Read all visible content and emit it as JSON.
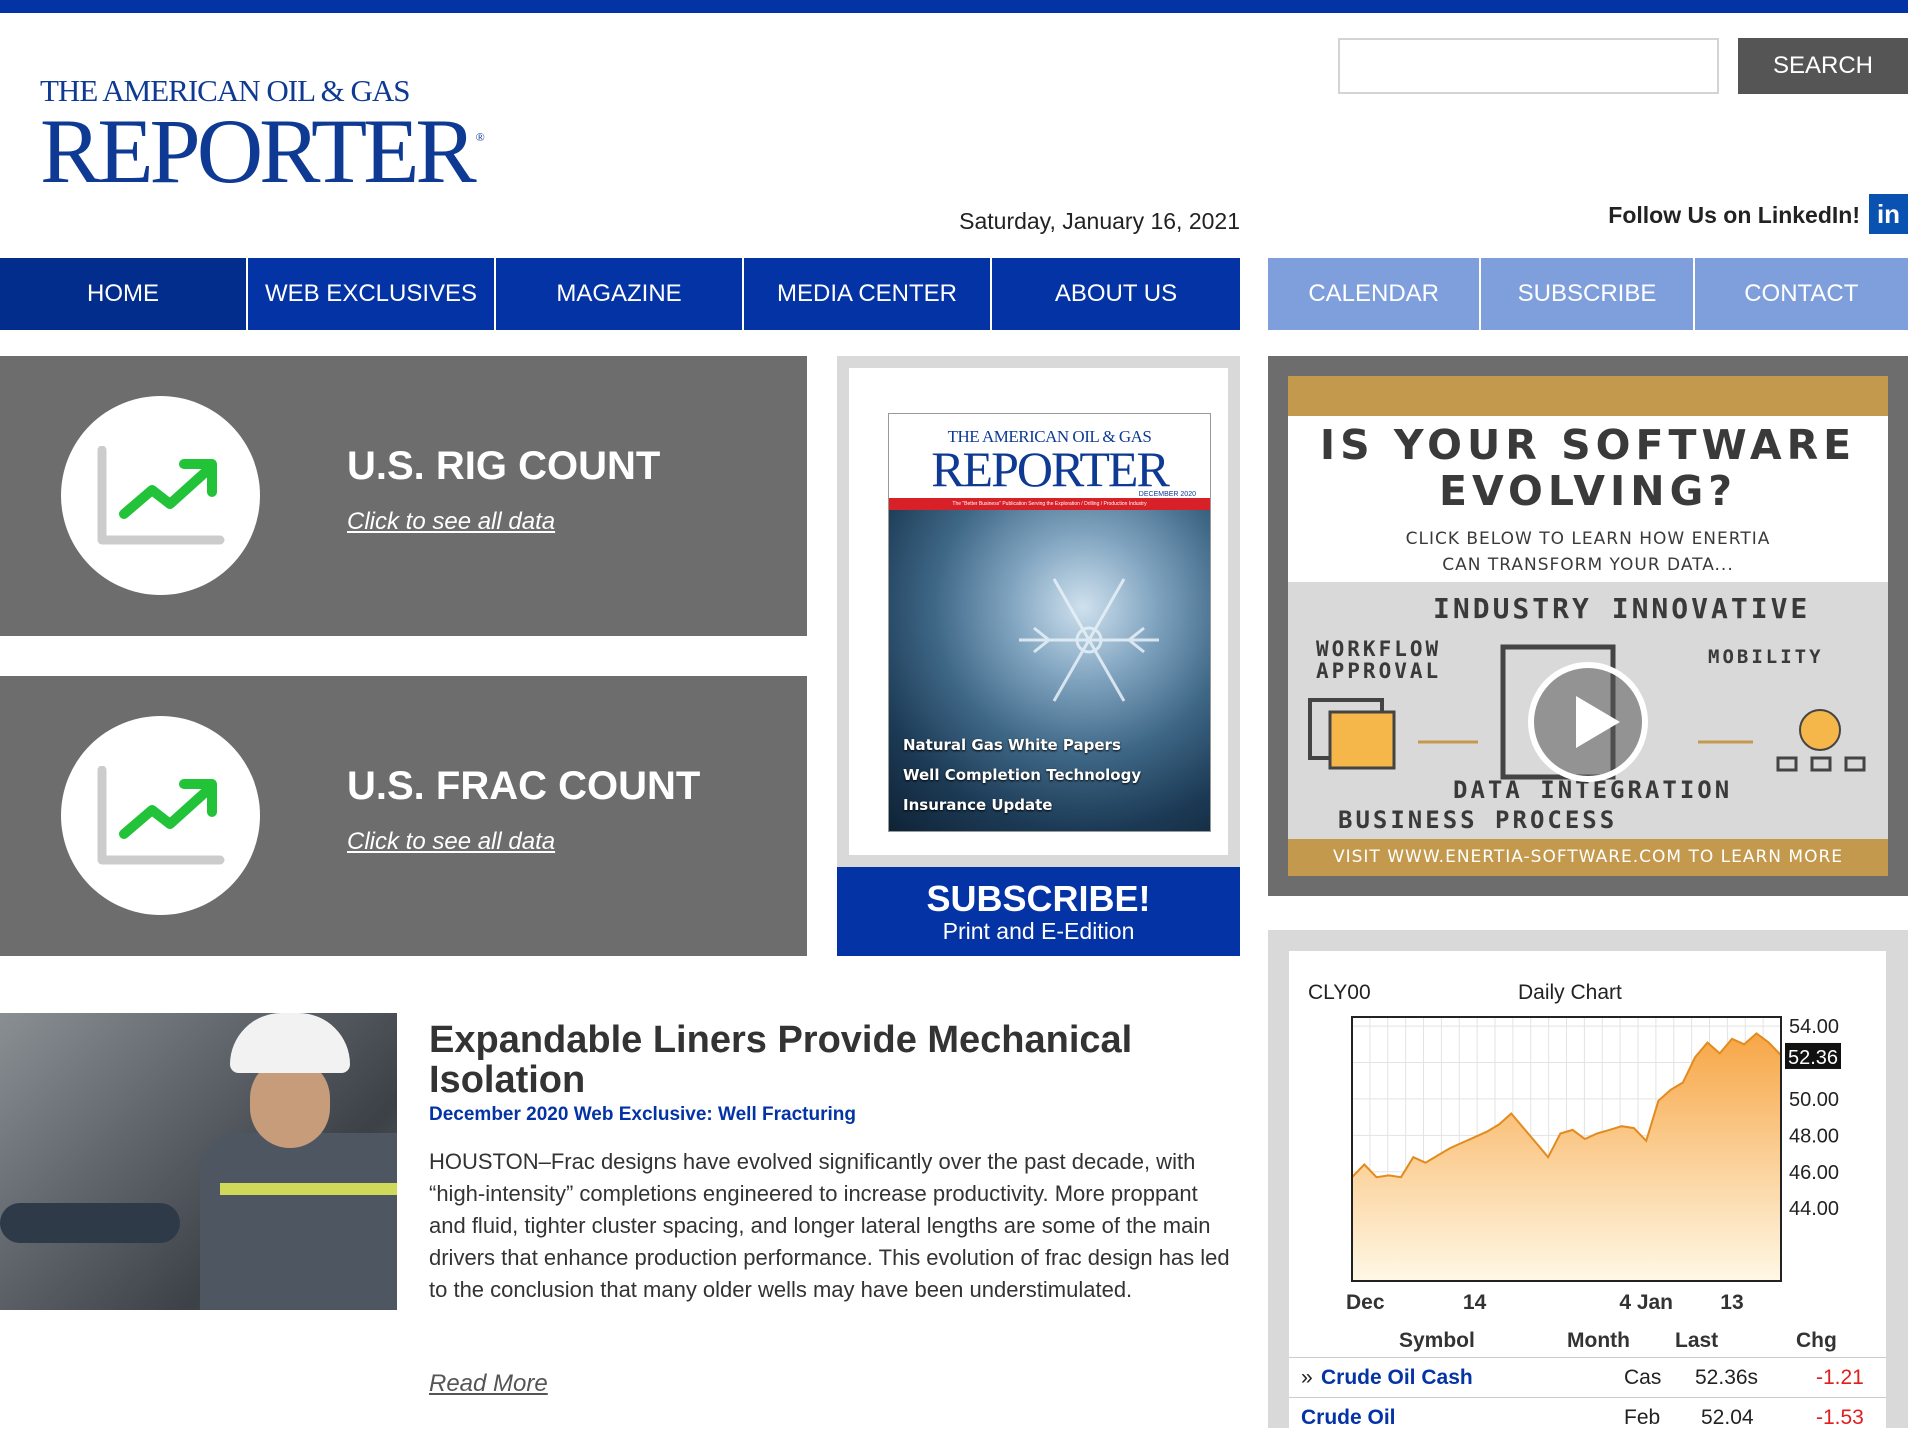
{
  "header": {
    "logo_line1": "THE AMERICAN OIL & GAS",
    "logo_line2": "REPORTER",
    "logo_reg": "®",
    "search_placeholder": "",
    "search_label": "SEARCH",
    "date": "Saturday, January 16, 2021",
    "follow_label": "Follow Us on LinkedIn!",
    "linkedin_icon": "in"
  },
  "nav": {
    "main": [
      {
        "label": "HOME"
      },
      {
        "label": "WEB EXCLUSIVES"
      },
      {
        "label": "MAGAZINE"
      },
      {
        "label": "MEDIA CENTER"
      },
      {
        "label": "ABOUT US"
      }
    ],
    "secondary": [
      {
        "label": "CALENDAR"
      },
      {
        "label": "SUBSCRIBE"
      },
      {
        "label": "CONTACT"
      }
    ]
  },
  "stats": [
    {
      "title": "U.S. RIG COUNT",
      "link": "Click to see all data",
      "icon": "trend-up-icon"
    },
    {
      "title": "U.S. FRAC COUNT",
      "link": "Click to see all data",
      "icon": "trend-up-icon"
    }
  ],
  "magazine": {
    "cover_line1": "THE AMERICAN OIL & GAS",
    "cover_line2": "REPORTER",
    "cover_date": "DECEMBER 2020",
    "cover_tagline": "The \"Better Business\" Publication Serving the Exploration / Drilling / Production Industry",
    "cover_items": [
      "Natural Gas White Papers",
      "Well Completion Technology",
      "Insurance Update"
    ],
    "subscribe_big": "SUBSCRIBE!",
    "subscribe_small": "Print and E-Edition"
  },
  "ad": {
    "headline1": "IS YOUR SOFTWARE",
    "headline2": "EVOLVING?",
    "sub1": "CLICK BELOW TO LEARN HOW ENERTIA",
    "sub2": "CAN TRANSFORM YOUR DATA...",
    "industry": "INDUSTRY INNOVATIVE",
    "workflow1": "WORKFLOW",
    "workflow2": "APPROVAL",
    "mobility": "MOBILITY",
    "data_integration": "DATA INTEGRATION",
    "business_process": "BUSINESS PROCESS",
    "visit": "VISIT   WWW.ENERTIA-SOFTWARE.COM   TO LEARN MORE"
  },
  "commodity": {
    "symbol": "CLY00",
    "chart_label": "Daily Chart",
    "last_price_tag": "52.36",
    "table_headers": {
      "symbol": "Symbol",
      "month": "Month",
      "last": "Last",
      "chg": "Chg"
    },
    "rows": [
      {
        "prefix": "»",
        "symbol": "Crude Oil Cash",
        "month": "Cas",
        "last": "52.36s",
        "chg": "-1.21"
      },
      {
        "prefix": "",
        "symbol": "Crude Oil",
        "month": "Feb",
        "last": "52.04",
        "chg": "-1.53"
      }
    ],
    "colors": {
      "fill_top": "#f7a646",
      "fill_bottom": "#fff8e6",
      "line": "#e38b1e"
    }
  },
  "chart_data": {
    "type": "area",
    "title": "Daily Chart",
    "x": [
      "Dec",
      "14",
      "4 Jan",
      "13"
    ],
    "y_ticks": [
      "54.00",
      "52.36",
      "50.00",
      "48.00",
      "46.00",
      "44.00"
    ],
    "ylim": [
      40,
      54.5
    ],
    "grid": true,
    "series": [
      {
        "values": [
          45.7,
          46.4,
          45.7,
          45.8,
          45.7,
          46.8,
          46.5,
          46.9,
          47.3,
          47.6,
          47.9,
          48.2,
          48.6,
          49.2,
          48.4,
          47.6,
          46.8,
          48.1,
          48.3,
          47.8,
          48.1,
          48.3,
          48.5,
          48.4,
          47.7,
          49.9,
          50.5,
          50.9,
          52.3,
          53.1,
          52.5,
          53.3,
          53.0,
          53.6,
          53.1,
          52.4
        ]
      }
    ]
  },
  "article": {
    "title": "Expandable Liners Provide Mechanical Isolation",
    "kicker": "December 2020 Web Exclusive: Well Fracturing",
    "body": "HOUSTON–Frac designs have evolved significantly over the past decade, with “high-intensity” completions engineered to increase productivity. More proppant and fluid, tighter cluster spacing, and longer lateral lengths are some of the main drivers that enhance production performance. This evolution of frac design has led to the conclusion that many older wells may have been understimulated.",
    "read_more": "Read More"
  }
}
